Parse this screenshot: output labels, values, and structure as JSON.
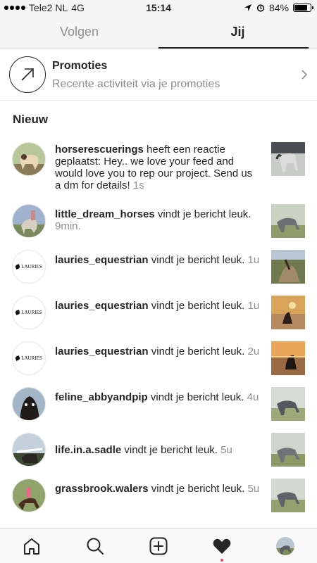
{
  "status": {
    "carrier": "Tele2 NL",
    "network": "4G",
    "time": "15:14",
    "battery": "84%",
    "battery_level": 0.84
  },
  "tabs": [
    {
      "label": "Volgen"
    },
    {
      "label": "Jij"
    }
  ],
  "promo": {
    "title": "Promoties",
    "subtitle": "Recente activiteit via je promoties",
    "icon": "arrow-up-right-icon"
  },
  "section": {
    "title": "Nieuw"
  },
  "notifications": [
    {
      "user": "horserescuerings",
      "text": " heeft een reactie geplaatst: Hey.. we love your feed and would love you to rep our project. Send us a dm for details!",
      "time": "1s"
    },
    {
      "user": "little_dream_horses",
      "text": " vindt je bericht leuk.",
      "time": "9min."
    },
    {
      "user": "lauries_equestrian",
      "text": " vindt je bericht leuk.",
      "time": "1u",
      "avatar_text": "LAURIES"
    },
    {
      "user": "lauries_equestrian",
      "text": " vindt je bericht leuk.",
      "time": "1u",
      "avatar_text": "LAURIES"
    },
    {
      "user": "lauries_equestrian",
      "text": " vindt je bericht leuk.",
      "time": "2u",
      "avatar_text": "LAURIES"
    },
    {
      "user": "feline_abbyandpip",
      "text": " vindt je bericht leuk.",
      "time": "4u"
    },
    {
      "user": "life.in.a.sadle",
      "text": " vindt je bericht leuk.",
      "time": "5u"
    },
    {
      "user": "grassbrook.walers",
      "text": " vindt je bericht leuk.",
      "time": "5u"
    }
  ],
  "nav": [
    {
      "icon": "home-icon"
    },
    {
      "icon": "search-icon"
    },
    {
      "icon": "add-post-icon"
    },
    {
      "icon": "heart-icon",
      "active": true
    },
    {
      "icon": "profile-avatar"
    }
  ],
  "colors": {
    "text": "#262626",
    "muted": "#8e8e8e",
    "notification_dot": "#ed4956"
  }
}
